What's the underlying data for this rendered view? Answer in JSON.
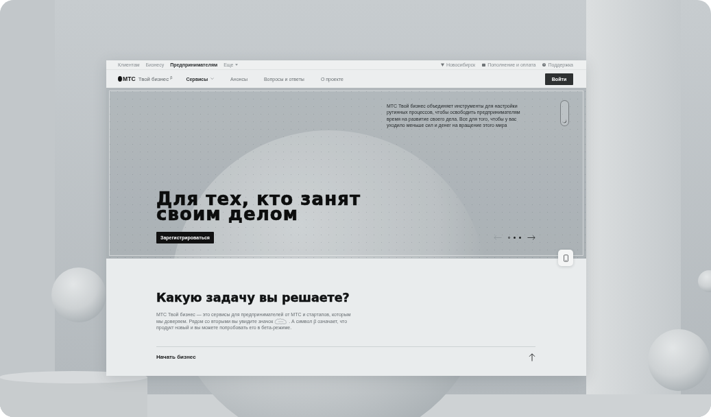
{
  "top_bar": {
    "segments": [
      {
        "label": "Клиентам",
        "kind": "link",
        "selected": false
      },
      {
        "label": "Бизнесу",
        "kind": "link",
        "selected": false
      },
      {
        "label": "Предпринимателям",
        "kind": "link",
        "selected": true
      },
      {
        "label": "Еще",
        "kind": "menu",
        "selected": false
      }
    ],
    "utilities": [
      {
        "kind": "location",
        "label": "Новосибирск"
      },
      {
        "kind": "payment",
        "label": "Пополнение и оплата"
      },
      {
        "kind": "help",
        "label": "Поддержка"
      }
    ]
  },
  "nav": {
    "logo": "**МТС** Твой бизнес $^{β}$",
    "items": [
      {
        "label": "Сервисы",
        "kind": "dropdown"
      },
      {
        "label": "Анонсы",
        "kind": "link"
      },
      {
        "label": "Вопросы и ответы",
        "kind": "link"
      },
      {
        "label": "О проекте",
        "kind": "link"
      }
    ],
    "login_button": "Войти"
  },
  "hero": {
    "description": "МТС Твой бизнес объединяет инструменты для настройки рутинных процессов, чтобы освободить предпринимателям время на развитие своего дела. Все для того, чтобы у вас уходило меньше сил и денег на вращение этого мира",
    "heading": "Для тех, кто занят своим делом",
    "cta": "Зарегистрироваться",
    "slides": [
      {
        "selected": true
      },
      {
        "selected": false
      },
      {
        "selected": false
      }
    ],
    "prev": {
      "disabled": true
    },
    "next": {
      "disabled": false
    }
  },
  "tasks": {
    "heading": "Какую задачу вы решаете?",
    "intro": {
      "before_icon": "МТС Твой бизнес — это сервисы для предпринимателей от МТС и стартапов, которым мы доверяем. Рядом со вторыми вы увидите значок",
      "after_icon": ". А символ β означает, что продукт новый и вы можете попробовать его в бета-режиме."
    },
    "accordion": [
      {
        "title": "Начать бизнес"
      }
    ]
  }
}
